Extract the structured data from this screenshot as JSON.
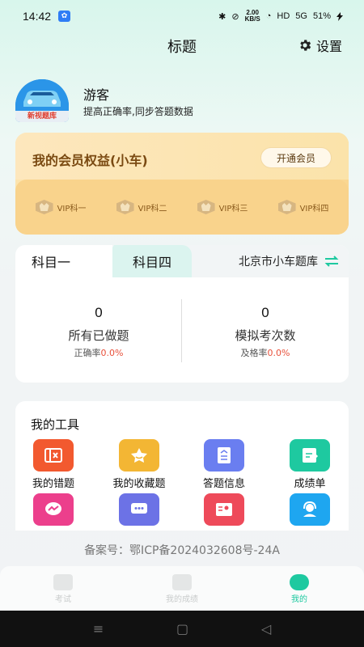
{
  "status_bar": {
    "time": "14:42",
    "app_icon_glyph": "✿",
    "bluetooth_glyph": "✱",
    "mute_glyph": "⊘",
    "net_speed_value": "2.00",
    "net_speed_unit": "KB/S",
    "wifi_glyph": "◔",
    "hd": "HD",
    "signal": "5G",
    "battery": "51%"
  },
  "header": {
    "title": "标题",
    "settings_label": "设置",
    "settings_icon": "gear-icon"
  },
  "user": {
    "name": "游客",
    "subtitle": "提高正确率,同步答题数据",
    "avatar_label": "新视题库"
  },
  "vip": {
    "title": "我的会员权益(小车)",
    "open_button": "开通会员",
    "items": [
      {
        "label": "VIP科一"
      },
      {
        "label": "VIP科二"
      },
      {
        "label": "VIP科三"
      },
      {
        "label": "VIP科四"
      }
    ]
  },
  "subjects": {
    "tab_one": "科目一",
    "tab_four": "科目四",
    "bank": "北京市小车题库",
    "stats": [
      {
        "value": "0",
        "label": "所有已做题",
        "rate_label": "正确率",
        "rate_value": "0.0%"
      },
      {
        "value": "0",
        "label": "模拟考次数",
        "rate_label": "及格率",
        "rate_value": "0.0%"
      }
    ]
  },
  "tools": {
    "title": "我的工具",
    "items": [
      {
        "label": "我的错题",
        "icon": "wrong-questions-icon",
        "color": "#f2592f"
      },
      {
        "label": "我的收藏题",
        "icon": "favorites-icon",
        "color": "#f3b634"
      },
      {
        "label": "答题信息",
        "icon": "answer-info-icon",
        "color": "#6a7ef0"
      },
      {
        "label": "成绩单",
        "icon": "score-sheet-icon",
        "color": "#1ec9a0"
      },
      {
        "label": "",
        "icon": "messenger-icon",
        "color": "#ec3f8c"
      },
      {
        "label": "",
        "icon": "chat-icon",
        "color": "#6c72e6"
      },
      {
        "label": "",
        "icon": "profile-card-icon",
        "color": "#ee4a5a"
      },
      {
        "label": "",
        "icon": "customer-service-icon",
        "color": "#1ea6f0"
      }
    ]
  },
  "icp": "备案号：鄂ICP备2024032608号-24A",
  "bottom_nav": {
    "items": [
      {
        "label": "考试",
        "icon": "exam-icon",
        "active": false
      },
      {
        "label": "我的成绩",
        "icon": "my-scores-icon",
        "active": false
      },
      {
        "label": "我的",
        "icon": "mine-icon",
        "active": true
      }
    ],
    "active_color": "#1ec9a0"
  },
  "android_nav": {
    "menu_glyph": "≡",
    "home_glyph": "▢",
    "back_glyph": "◁"
  }
}
